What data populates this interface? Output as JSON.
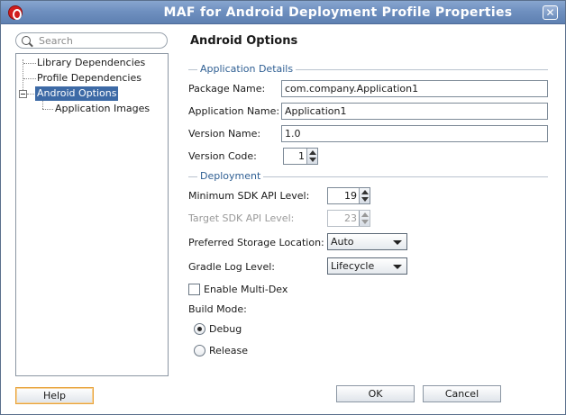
{
  "window": {
    "title": "MAF for Android Deployment Profile Properties"
  },
  "search": {
    "placeholder": "Search"
  },
  "tree": {
    "items": [
      {
        "label": "Library Dependencies"
      },
      {
        "label": "Profile Dependencies"
      },
      {
        "label": "Android Options",
        "selected": true
      },
      {
        "label": "Application Images"
      }
    ]
  },
  "page": {
    "title": "Android Options",
    "application_details": {
      "section_label": "Application Details",
      "package_name": {
        "label": "Package Name:",
        "value": "com.company.Application1"
      },
      "application_name": {
        "label": "Application Name:",
        "value": "Application1"
      },
      "version_name": {
        "label": "Version Name:",
        "value": "1.0"
      },
      "version_code": {
        "label": "Version Code:",
        "value": "1"
      }
    },
    "deployment": {
      "section_label": "Deployment",
      "min_sdk": {
        "label": "Minimum SDK API Level:",
        "value": "19"
      },
      "target_sdk": {
        "label": "Target SDK API Level:",
        "value": "23",
        "disabled": true
      },
      "storage": {
        "label": "Preferred Storage Location:",
        "value": "Auto"
      },
      "gradle": {
        "label": "Gradle Log Level:",
        "value": "Lifecycle"
      },
      "multidex": {
        "label": "Enable Multi-Dex",
        "checked": false
      },
      "build_mode": {
        "label": "Build Mode:",
        "options": [
          {
            "label": "Debug",
            "checked": true
          },
          {
            "label": "Release",
            "checked": false
          }
        ]
      }
    }
  },
  "buttons": {
    "help": "Help",
    "ok": "OK",
    "cancel": "Cancel"
  },
  "colors": {
    "titlebar": "#6f90c0",
    "selection": "#3d6aa6",
    "section_text": "#2f5f93",
    "focus_border": "#e8a33b"
  }
}
